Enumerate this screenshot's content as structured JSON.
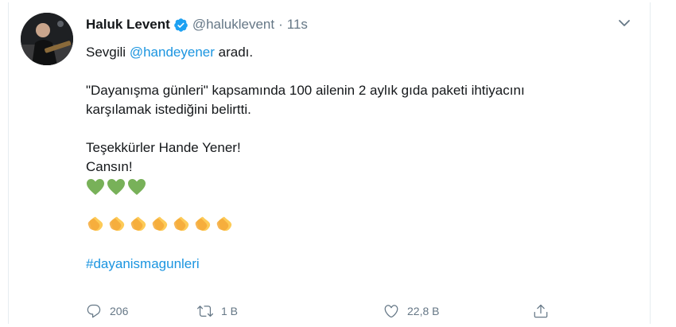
{
  "tweet": {
    "author": {
      "name": "Haluk Levent",
      "handle": "@haluklevent",
      "separator": "·",
      "time": "11s"
    },
    "lines": {
      "line1_prefix": "Sevgili",
      "mention": "@handeyener",
      "line1_suffix": "aradı.",
      "para2_line1": "\"Dayanışma günleri\" kapsamında 100 ailenin 2 aylık gıda paketi ihtiyacını",
      "para2_line2": "karşılamak istediğini belirtti.",
      "para3_line1": "Teşekkürler Hande Yener!",
      "para3_line2": "Cansın!",
      "hashtag": "#dayanismagunleri"
    },
    "emoji": {
      "hearts_count": 3,
      "hearts_color": "#78b159",
      "claps_count": 7,
      "claps_color": "#fdcb58"
    },
    "actions": {
      "replies": "206",
      "retweets": "1 B",
      "likes": "22,8 B"
    }
  },
  "colors": {
    "link": "#1b95e0",
    "verified": "#1da1f2",
    "muted": "#657786",
    "text": "#14171a"
  },
  "icons": [
    "verified-badge-icon",
    "chevron-down-icon",
    "reply-icon",
    "retweet-icon",
    "like-icon",
    "share-icon",
    "green-heart-icon",
    "clapping-hands-icon"
  ]
}
